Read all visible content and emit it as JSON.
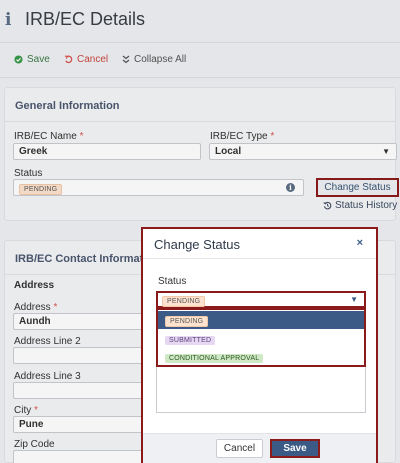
{
  "header": {
    "title": "IRB/EC Details",
    "icon": "info-icon"
  },
  "toolbar": {
    "save_label": "Save",
    "cancel_label": "Cancel",
    "collapse_label": "Collapse All"
  },
  "general": {
    "title": "General Information",
    "name_label": "IRB/EC Name",
    "name_required": "*",
    "name_value": "Greek",
    "type_label": "IRB/EC Type",
    "type_required": "*",
    "type_value": "Local",
    "status_label": "Status",
    "status_value": "PENDING",
    "change_status_label": "Change Status",
    "status_history_label": "Status History"
  },
  "contact": {
    "title": "IRB/EC Contact Information",
    "address_heading": "Address",
    "address_label": "Address",
    "address_required": "*",
    "address_value": "Aundh",
    "address2_label": "Address Line 2",
    "address3_label": "Address Line 3",
    "city_label": "City",
    "city_required": "*",
    "city_value": "Pune",
    "zip_label": "Zip Code"
  },
  "modal": {
    "title": "Change Status",
    "close": "×",
    "status_label": "Status",
    "selected": "PENDING",
    "options": [
      "PENDING",
      "SUBMITTED",
      "CONDITIONAL APPROVAL"
    ],
    "cancel_label": "Cancel",
    "save_label": "Save"
  },
  "colors": {
    "accent": "#3b5a86",
    "highlight_border": "#8b1a1a",
    "pending": "#fde3cf",
    "submitted": "#e6d8f3",
    "conditional": "#cfe8c6"
  }
}
